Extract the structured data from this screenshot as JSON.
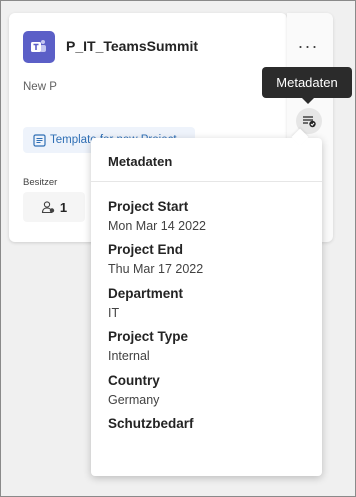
{
  "card": {
    "title": "P_IT_TeamsSummit",
    "description": "New P",
    "tag_label": "Template for new Project",
    "owner_label": "Besitzer",
    "owner_count": "1",
    "more_label": "···"
  },
  "tooltip": {
    "text": "Metadaten"
  },
  "metadata_panel": {
    "title": "Metadaten",
    "fields": [
      {
        "label": "Project Start",
        "value": "Mon Mar 14 2022"
      },
      {
        "label": "Project End",
        "value": "Thu Mar 17 2022"
      },
      {
        "label": "Department",
        "value": "IT"
      },
      {
        "label": "Project Type",
        "value": "Internal"
      },
      {
        "label": "Country",
        "value": "Germany"
      },
      {
        "label": "Schutzbedarf",
        "value": ""
      }
    ]
  },
  "colors": {
    "accent": "#5b5fc7",
    "link": "#2f6fb5",
    "tooltip_bg": "#2b2b2b"
  }
}
